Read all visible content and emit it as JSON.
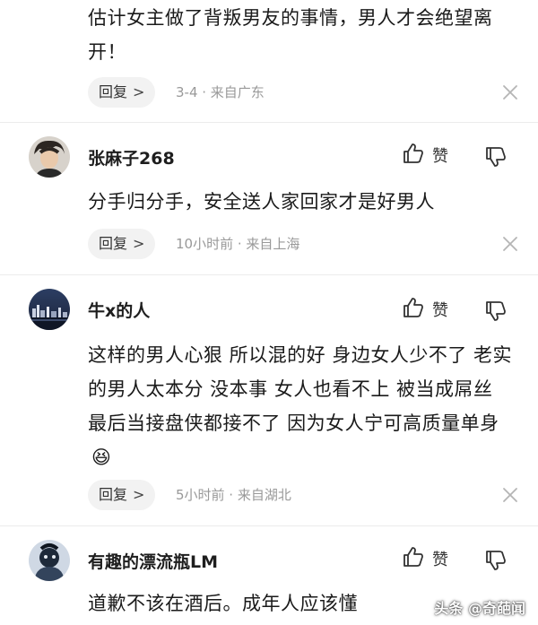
{
  "comments": [
    {
      "text": "估计女主做了背叛男友的事情，男人才会绝望离开！",
      "reply": "回复",
      "meta": "3-4 · 来自广东"
    },
    {
      "username": "张麻子268",
      "text": "分手归分手，安全送人家回家才是好男人",
      "reply": "回复",
      "meta": "10小时前 · 来自上海",
      "like_label": "赞"
    },
    {
      "username": "牛x的人",
      "text": "这样的男人心狠 所以混的好 身边女人少不了 老实的男人太本分 没本事 女人也看不上 被当成屌丝 最后当接盘侠都接不了 因为女人宁可高质量单身",
      "emoji": "😆",
      "reply": "回复",
      "meta": "5小时前 · 来自湖北",
      "like_label": "赞"
    },
    {
      "username": "有趣的漂流瓶LM",
      "text": "道歉不该在酒后。成年人应该懂",
      "like_label": "赞"
    }
  ],
  "icons": {
    "reply_chevron": ">",
    "like": "thumbs-up-icon",
    "dislike": "thumbs-down-icon",
    "dismiss": "close-icon"
  },
  "watermark": "头条 @奇葩闻",
  "colors": {
    "background": "#ffffff",
    "text": "#1a1a1a",
    "meta": "#999999",
    "pill": "#f2f2f2"
  }
}
